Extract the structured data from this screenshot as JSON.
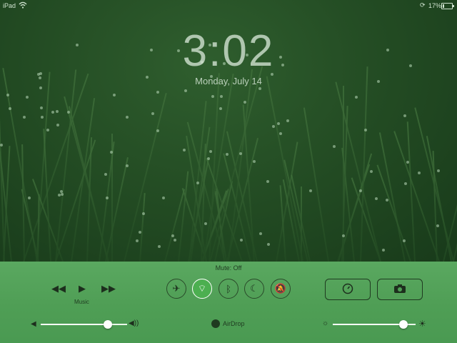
{
  "status_bar": {
    "device": "iPad",
    "wifi_icon": "wifi-icon",
    "lock_icon": "orientation-lock-icon",
    "battery_percent": "17%",
    "battery_level": 0.17
  },
  "lock_screen": {
    "time": "3:02",
    "date": "Monday, July 14"
  },
  "control_center": {
    "mute_status": "Mute: Off",
    "media": {
      "rewind_icon": "rewind-icon",
      "play_icon": "play-icon",
      "forward_icon": "fast-forward-icon",
      "source_label": "Music"
    },
    "toggles": [
      {
        "name": "airplane-mode-icon",
        "glyph": "✈",
        "active": false
      },
      {
        "name": "wifi-icon",
        "glyph": "⌔",
        "active": true
      },
      {
        "name": "bluetooth-icon",
        "glyph": "ᛒ",
        "active": false
      },
      {
        "name": "do-not-disturb-icon",
        "glyph": "☾",
        "active": false
      },
      {
        "name": "mute-bell-icon",
        "glyph": "🔕",
        "active": false
      }
    ],
    "timer_icon": "timer-icon",
    "camera_icon": "camera-icon",
    "volume": {
      "level": 0.78,
      "low_icon": "volume-low-icon",
      "high_icon": "volume-high-icon"
    },
    "airdrop_label": "AirDrop",
    "brightness": {
      "level": 0.85,
      "low_icon": "brightness-low-icon",
      "high_icon": "brightness-high-icon"
    }
  }
}
